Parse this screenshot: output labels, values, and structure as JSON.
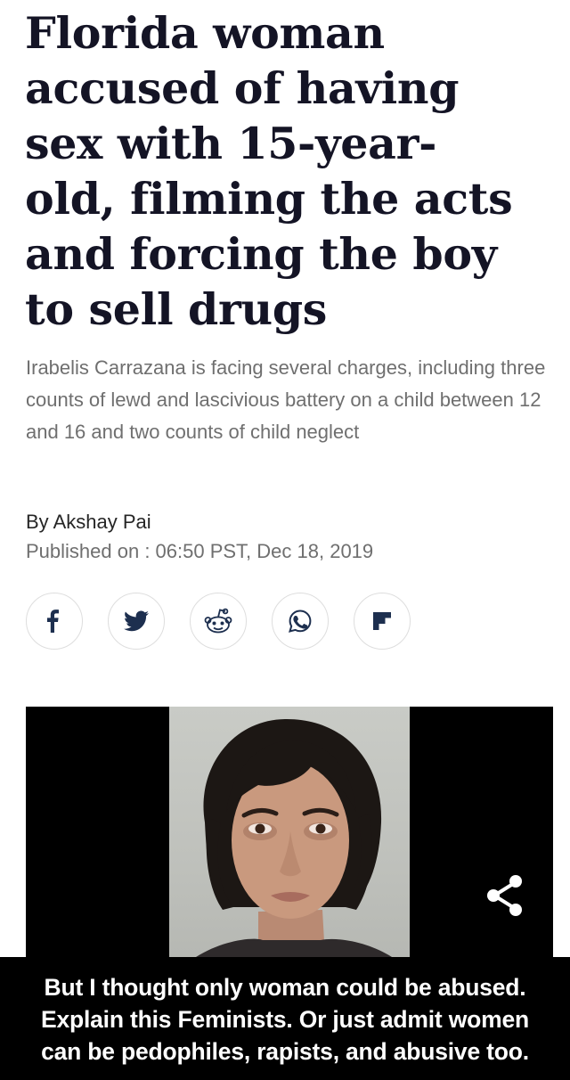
{
  "article": {
    "headline": "Florida woman accused of having sex with 15-year-old, filming the acts and forcing the boy to sell drugs",
    "headline_lines": [
      "Florida woman",
      "accused of having",
      "sex with 15-year-",
      "old, filming the acts",
      "and forcing the boy",
      "to sell drugs"
    ],
    "subtitle": "Irabelis Carrazana is facing several charges, including three counts of lewd and lascivious battery on a child between 12 and 16 and two counts of child neglect",
    "byline": "By Akshay Pai",
    "published": "Published on : 06:50 PST, Dec 18, 2019"
  },
  "share_buttons": [
    {
      "icon": "facebook-icon"
    },
    {
      "icon": "twitter-icon"
    },
    {
      "icon": "reddit-icon"
    },
    {
      "icon": "whatsapp-icon"
    },
    {
      "icon": "flipboard-icon"
    }
  ],
  "photo": {
    "share_icon": "share-icon"
  },
  "caption": {
    "lines": [
      "But I thought only woman could be abused.",
      "Explain this Feminists. Or just admit women",
      "can be pedophiles, rapists, and abusive too."
    ]
  },
  "colors": {
    "headline": "#141425",
    "subtitle": "#6f6f6f",
    "caption_bg": "#000000",
    "caption_text": "#ffffff",
    "share_border": "#dedede",
    "twitter": "#1d2f4f"
  }
}
